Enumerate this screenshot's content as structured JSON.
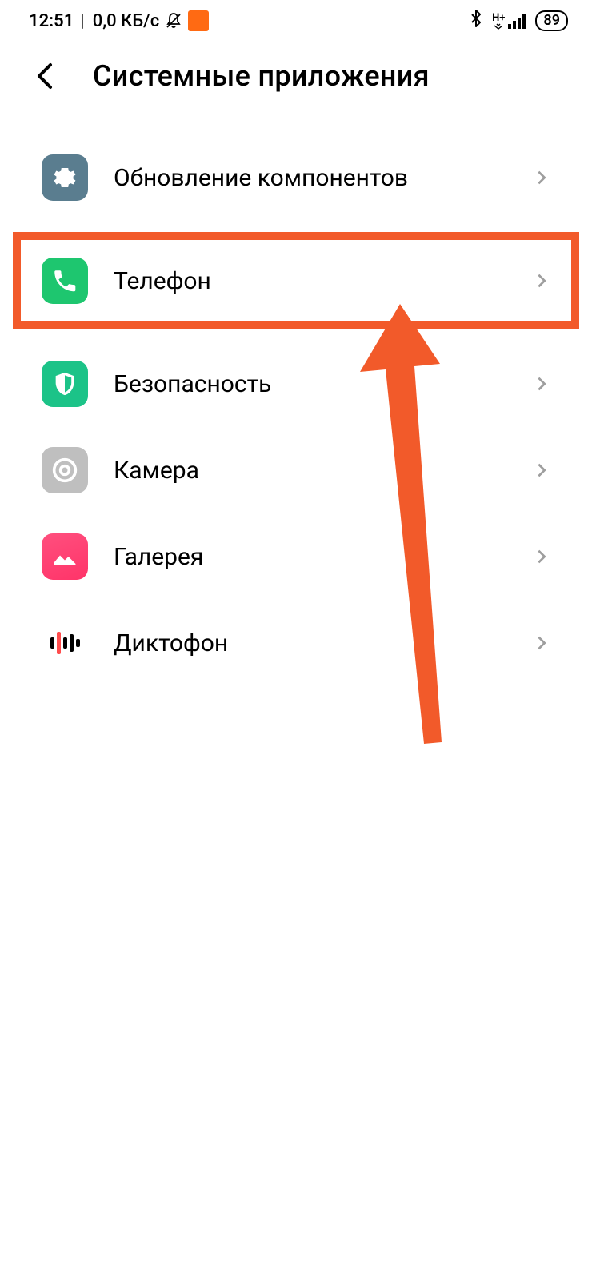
{
  "status": {
    "time": "12:51",
    "separator": "|",
    "speed": "0,0 КБ/с",
    "network_label": "H+",
    "battery": "89"
  },
  "header": {
    "title": "Системные приложения"
  },
  "items": [
    {
      "label": "Обновление компонентов",
      "icon": "gear-icon",
      "highlighted": false
    },
    {
      "label": "Телефон",
      "icon": "phone-icon",
      "highlighted": true
    },
    {
      "label": "Безопасность",
      "icon": "shield-icon",
      "highlighted": false
    },
    {
      "label": "Камера",
      "icon": "camera-icon",
      "highlighted": false
    },
    {
      "label": "Галерея",
      "icon": "gallery-icon",
      "highlighted": false
    },
    {
      "label": "Диктофон",
      "icon": "recorder-icon",
      "highlighted": false
    }
  ],
  "colors": {
    "highlight": "#f25a2a"
  }
}
